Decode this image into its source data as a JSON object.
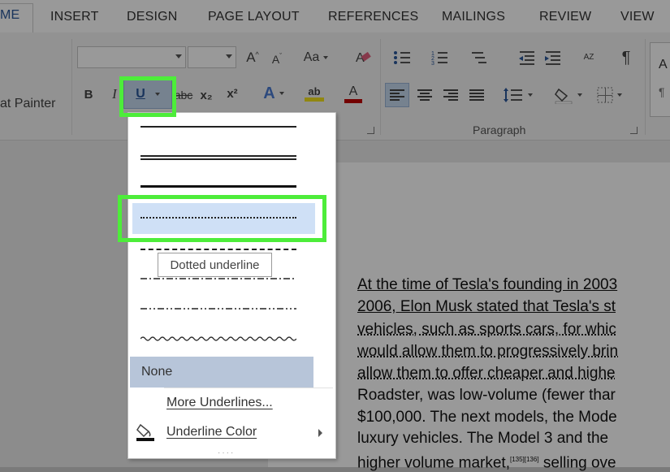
{
  "tabs": [
    "ME",
    "INSERT",
    "DESIGN",
    "PAGE LAYOUT",
    "REFERENCES",
    "MAILINGS",
    "REVIEW",
    "VIEW"
  ],
  "clipboard": {
    "format_painter_label": "at Painter"
  },
  "font": {
    "name_value": "",
    "size_value": "",
    "grow_label": "A",
    "shrink_label": "A",
    "case_label": "Aa",
    "bold_label": "B",
    "italic_label": "I",
    "underline_label": "U",
    "strike_label": "abc",
    "subscript_label": "x₂",
    "superscript_label": "x²",
    "text_effects_label": "A",
    "highlight_label": "ab",
    "font_color_label": "A"
  },
  "paragraph": {
    "group_label": "Paragraph",
    "pilcrow_label": "¶",
    "sort_label": "AZ"
  },
  "styles": {
    "preview_label": "A"
  },
  "underline_menu": {
    "tooltip": "Dotted underline",
    "none_label": "None",
    "more_label": "More Underlines...",
    "color_label": "Underline Color"
  },
  "document": {
    "lines": [
      "At the time of Tesla's founding in 2003",
      "2006, Elon Musk stated that Tesla's st",
      "vehicles, such as sports cars, for whic",
      "would allow them to progressively brin",
      "allow them to offer cheaper and highe",
      "Roadster, was low-volume (fewer thar",
      "$100,000. The next models, the Mode",
      "luxury vehicles. The Model 3 and the",
      "higher volume market,",
      "[135][136]",
      " selling ove"
    ]
  },
  "colors": {
    "highlight_green": "#4ded3a",
    "accent_blue": "#2b579a",
    "font_color_red": "#c00000",
    "highlight_yellow": "#f2e21b"
  }
}
